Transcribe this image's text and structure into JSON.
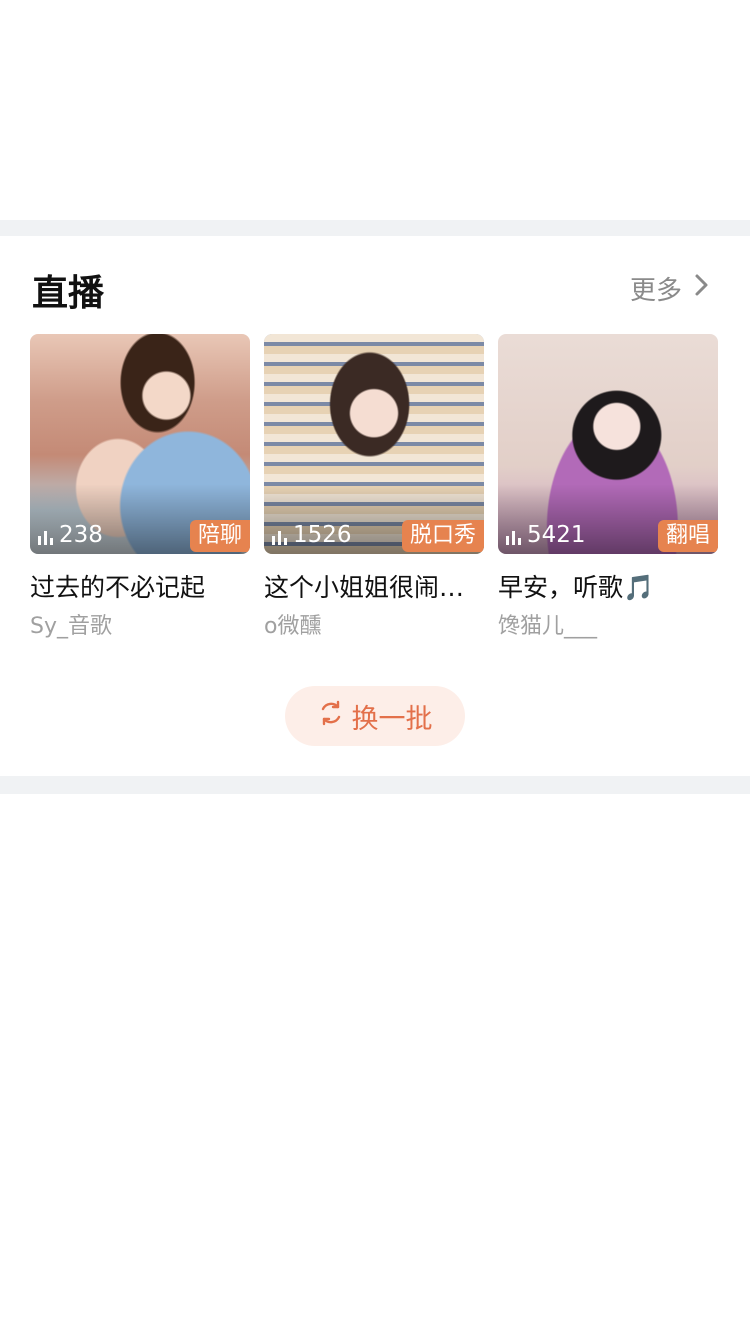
{
  "live": {
    "title": "直播",
    "more_label": "更多",
    "cards": [
      {
        "viewers": "238",
        "tag": "陪聊",
        "title": "过去的不必记起",
        "author": "Sy_音歌"
      },
      {
        "viewers": "1526",
        "tag": "脱口秀",
        "title": "这个小姐姐很闹…",
        "author": "o微醺"
      },
      {
        "viewers": "5421",
        "tag": "翻唱",
        "title": "早安，听歌🎵",
        "author": "馋猫儿___"
      }
    ],
    "refresh_label": "换一批"
  },
  "colors": {
    "accent": "#e6834f",
    "refresh_bg": "#fdeee8",
    "divider": "#f0f2f4"
  },
  "icons": {
    "more": "chevron-right-icon",
    "viewers": "signal-bars-icon",
    "refresh": "refresh-icon"
  }
}
